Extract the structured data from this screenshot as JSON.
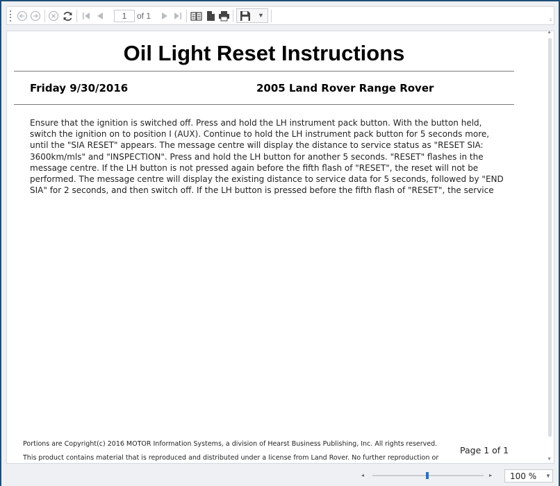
{
  "toolbar": {
    "current_page": "1",
    "page_count_label": "of 1",
    "icons": [
      "back-icon",
      "forward-icon",
      "stop-icon",
      "refresh-icon",
      "first-page-icon",
      "previous-page-icon",
      "next-page-icon",
      "last-page-icon",
      "print-layout-icon",
      "page-setup-icon",
      "print-icon",
      "save-icon",
      "dropdown-arrow-icon"
    ]
  },
  "report": {
    "title": "Oil Light Reset Instructions",
    "date": "Friday 9/30/2016",
    "vehicle": "2005 Land Rover Range Rover",
    "body": "Ensure that the ignition is switched off. Press and hold the LH instrument pack button. With the button held, switch the ignition on to position I (AUX). Continue to hold the LH instrument pack button for 5 seconds more, until the \"SIA RESET\" appears. The message centre will display the distance to service status as \"RESET SIA: 3600km/mls\" and \"INSPECTION\". Press and hold the LH button for another 5 seconds. \"RESET\" flashes in the message centre. If the LH button is not pressed again before the fifth flash of \"RESET\", the reset will not be performed. The message centre will display the existing distance to service data for 5 seconds, followed by \"END SIA\" for 2 seconds, and then switch off. If the LH button is pressed before the fifth flash of \"RESET\", the service distance will be reset. The",
    "copyright": "Portions are Copyright(c) 2016 MOTOR Information Systems, a division of Hearst Business Publishing, Inc. All rights reserved.",
    "license": "This product contains material that is reproduced and distributed under a license from Land Rover. No further reproduction or",
    "page_footer": "Page 1 of 1"
  },
  "status": {
    "zoom": "100 %",
    "zoom_level_percent": 100
  },
  "colors": {
    "window_frame": "#1f4e79",
    "zoom_thumb": "#2c6fbb",
    "background": "#eef0f3"
  }
}
